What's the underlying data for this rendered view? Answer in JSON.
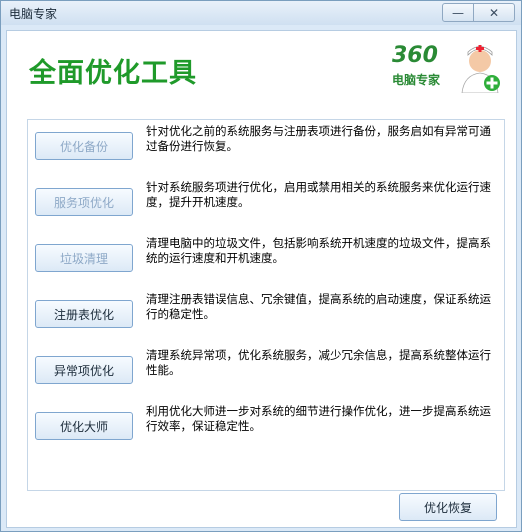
{
  "window": {
    "title": "电脑专家",
    "minimize_glyph": "—",
    "close_glyph": "✕"
  },
  "header": {
    "title": "全面优化工具",
    "logo_number": "360",
    "logo_brand": "电脑专家"
  },
  "rows": [
    {
      "button": "优化备份",
      "enabled": false,
      "description": "针对优化之前的系统服务与注册表项进行备份，服务启如有异常可通过备份进行恢复。"
    },
    {
      "button": "服务项优化",
      "enabled": false,
      "description": "针对系统服务项进行优化，启用或禁用相关的系统服务来优化运行速度，提升开机速度。"
    },
    {
      "button": "垃圾清理",
      "enabled": false,
      "description": "清理电脑中的垃圾文件，包括影响系统开机速度的垃圾文件，提高系统的运行速度和开机速度。"
    },
    {
      "button": "注册表优化",
      "enabled": true,
      "description": "清理注册表错误信息、冗余键值，提高系统的启动速度，保证系统运行的稳定性。"
    },
    {
      "button": "异常项优化",
      "enabled": true,
      "description": "清理系统异常项，优化系统服务，减少冗余信息，提高系统整体运行性能。"
    },
    {
      "button": "优化大师",
      "enabled": true,
      "description": "利用优化大师进一步对系统的细节进行操作优化，进一步提高系统运行效率，保证稳定性。"
    }
  ],
  "footer": {
    "restore_button": "优化恢复"
  }
}
